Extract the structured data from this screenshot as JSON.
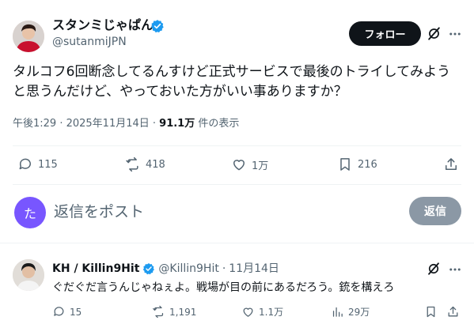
{
  "main_post": {
    "display_name": "スタンミじゃぱん",
    "handle": "@sutanmiJPN",
    "follow_label": "フォロー",
    "text": "タルコフ6回断念してるんすけど正式サービスで最後のトライしてみようと思うんだけど、やっておいた方がいい事ありますか？",
    "time": "午後1:29 · 2025年11月14日 · ",
    "views": "91.1万",
    "views_suffix": " 件の表示",
    "replies": "115",
    "reposts": "418",
    "likes": "1万",
    "bookmarks": "216"
  },
  "composer": {
    "avatar_letter": "た",
    "placeholder": "返信をポスト",
    "reply_button": "返信"
  },
  "reply_post": {
    "display_name": "KH / Killin9Hit",
    "handle": "@Killin9Hit",
    "separator": "·",
    "date": "11月14日",
    "text": "ぐだぐだ言うんじゃねぇよ。戦場が目の前にあるだろう。銃を構えろ",
    "replies": "15",
    "reposts": "1,191",
    "likes": "1.1万",
    "views": "29万"
  },
  "colors": {
    "verified": "#1d9bf0",
    "muted_text": "#536471",
    "follow_bg": "#0f1419",
    "composer_avatar": "#7856ff",
    "reply_button_bg": "#8b98a5"
  }
}
